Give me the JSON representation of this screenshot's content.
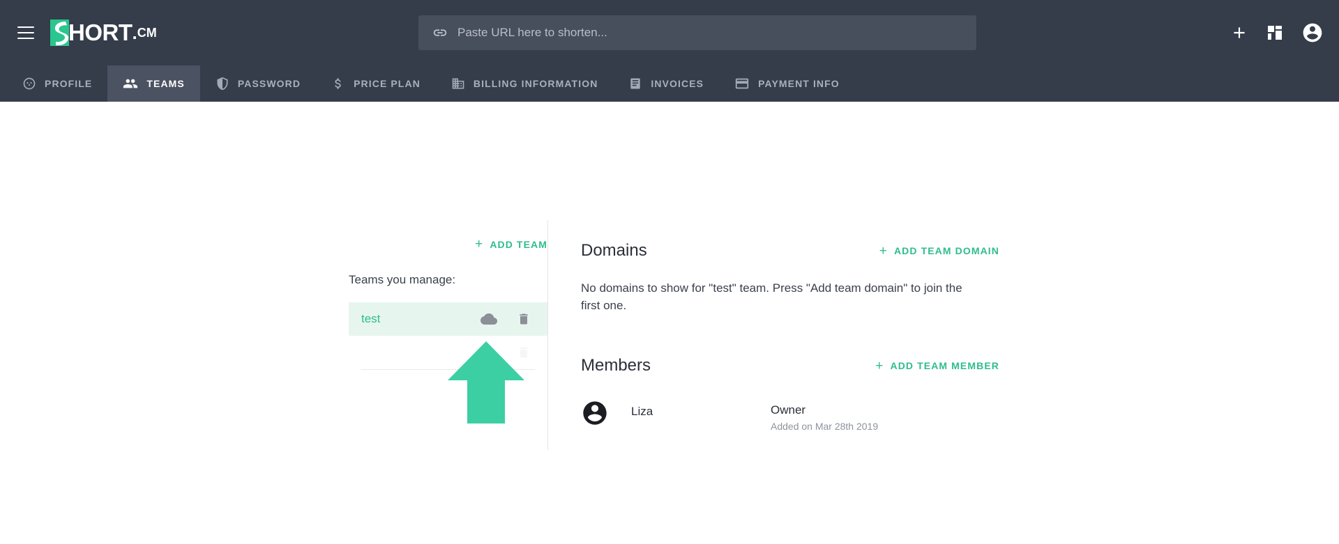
{
  "brand": {
    "name_main": "HORT",
    "name_suffix": "CM",
    "dot": ".",
    "logo_mark_letter": "S",
    "accent_color": "#2ebd8e",
    "header_bg": "#353c4a",
    "active_tab_bg": "#4b5261"
  },
  "header": {
    "menu_icon": "hamburger-icon",
    "url_input": {
      "value": "",
      "placeholder": "Paste URL here to shorten...",
      "icon": "link-icon"
    },
    "actions": [
      {
        "name": "add-button",
        "icon": "plus-icon"
      },
      {
        "name": "dashboard-button",
        "icon": "grid-icon"
      },
      {
        "name": "account-button",
        "icon": "account-circle-icon"
      }
    ]
  },
  "tabs": [
    {
      "label": "PROFILE",
      "icon": "profile-icon",
      "active": false
    },
    {
      "label": "TEAMS",
      "icon": "people-icon",
      "active": true
    },
    {
      "label": "PASSWORD",
      "icon": "shield-icon",
      "active": false
    },
    {
      "label": "PRICE PLAN",
      "icon": "dollar-icon",
      "active": false
    },
    {
      "label": "BILLING INFORMATION",
      "icon": "building-icon",
      "active": false
    },
    {
      "label": "INVOICES",
      "icon": "invoice-icon",
      "active": false
    },
    {
      "label": "PAYMENT INFO",
      "icon": "credit-card-icon",
      "active": false
    }
  ],
  "teams_panel": {
    "add_team_label": "ADD TEAM",
    "manage_label": "Teams you manage:",
    "teams": [
      {
        "name": "test",
        "selected": true,
        "actions": [
          {
            "name": "team-domains-icon",
            "icon": "cloud-icon"
          },
          {
            "name": "delete-team-icon",
            "icon": "trash-icon"
          }
        ]
      },
      {
        "name": "",
        "selected": false,
        "actions": [
          {
            "name": "team-domains-icon",
            "icon": "cloud-icon"
          },
          {
            "name": "delete-team-icon",
            "icon": "trash-icon"
          }
        ]
      }
    ]
  },
  "domains": {
    "title": "Domains",
    "add_label": "ADD TEAM DOMAIN",
    "empty_message": "No domains to show for \"test\" team. Press \"Add team domain\" to join the first one."
  },
  "members": {
    "title": "Members",
    "add_label": "ADD TEAM MEMBER",
    "list": [
      {
        "avatar": "account-circle-icon",
        "name": "Liza",
        "role": "Owner",
        "added": "Added on Mar 28th 2019"
      }
    ]
  },
  "annotation": {
    "arrow": "up-arrow-annotation",
    "color": "#3ccfa3"
  }
}
